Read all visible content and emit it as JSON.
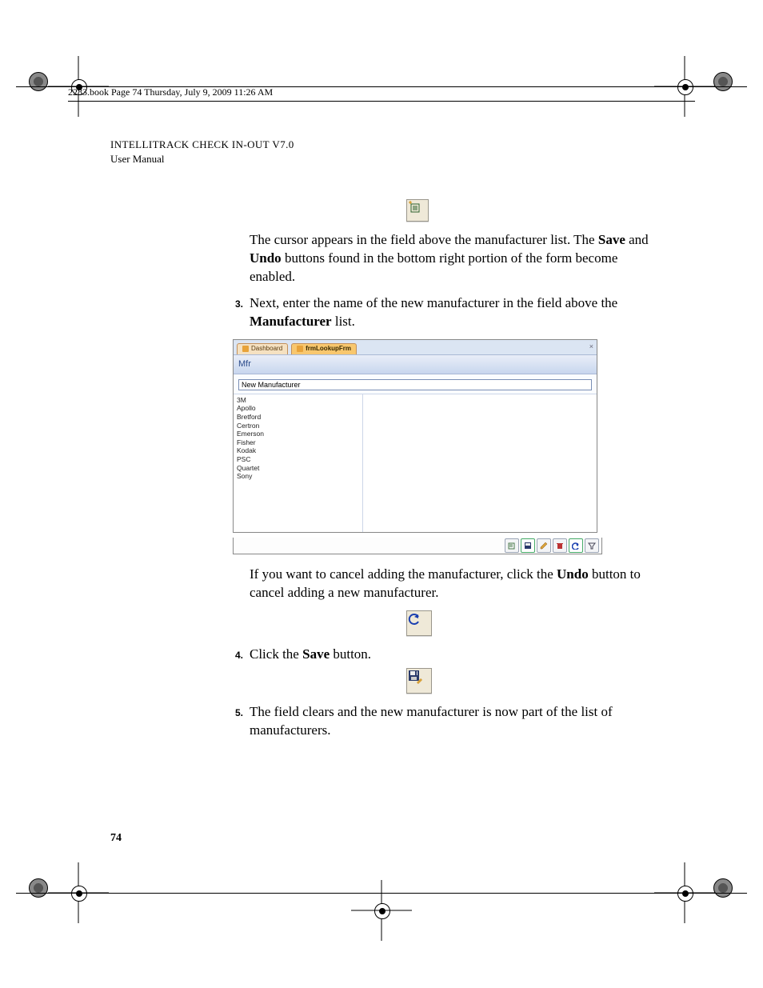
{
  "headerLine": "2283.book  Page 74  Thursday, July 9, 2009   11:26 AM",
  "runningTitle": {
    "line1_pre": "I",
    "line1_sc1": "NTELLI",
    "line1_mid": "T",
    "line1_sc2": "RACK",
    "line1_mid2": " C",
    "line1_sc3": "HECK ",
    "line1_mid3": "I",
    "line1_sc4": "N",
    "line1_mid4": "-O",
    "line1_sc5": "UT ",
    "line1_mid5": "V",
    "line1_ver": "7.0",
    "line2": "User Manual"
  },
  "body": {
    "p1a": "The cursor appears in the field above the manufacturer list. The ",
    "p1b_bold": "Save",
    "p1c": " and ",
    "p1d_bold": "Undo",
    "p1e": " buttons found in the bottom right portion of the form become enabled.",
    "step3_num": "3.",
    "step3a": "Next, enter the name of the new manufacturer in the field above the ",
    "step3b_bold": "Manufacturer",
    "step3c": " list.",
    "p2a": "If you want to cancel adding the manufacturer, click the ",
    "p2b_bold": "Undo",
    "p2c": " button to cancel adding a new manufacturer.",
    "step4_num": "4.",
    "step4a": "Click the ",
    "step4b_bold": "Save",
    "step4c": " button.",
    "step5_num": "5.",
    "step5": "The field clears and the new manufacturer is now part of the list of manufacturers."
  },
  "screenshot": {
    "tab_dashboard": "Dashboard",
    "tab_form": "frmLookupFrm",
    "header": "Mfr",
    "input_value": "New Manufacturer",
    "list_items": [
      "3M",
      "Apollo",
      "Bretford",
      "Certron",
      "Emerson",
      "Fisher",
      "Kodak",
      "PSC",
      "Quartet",
      "Sony"
    ],
    "toolbar_buttons": [
      {
        "name": "new-button",
        "glyph": "new"
      },
      {
        "name": "save-button",
        "glyph": "save"
      },
      {
        "name": "edit-button",
        "glyph": "edit"
      },
      {
        "name": "delete-button",
        "glyph": "delete"
      },
      {
        "name": "undo-button",
        "glyph": "undo"
      },
      {
        "name": "filter-button",
        "glyph": "filter"
      }
    ]
  },
  "page_number": "74"
}
